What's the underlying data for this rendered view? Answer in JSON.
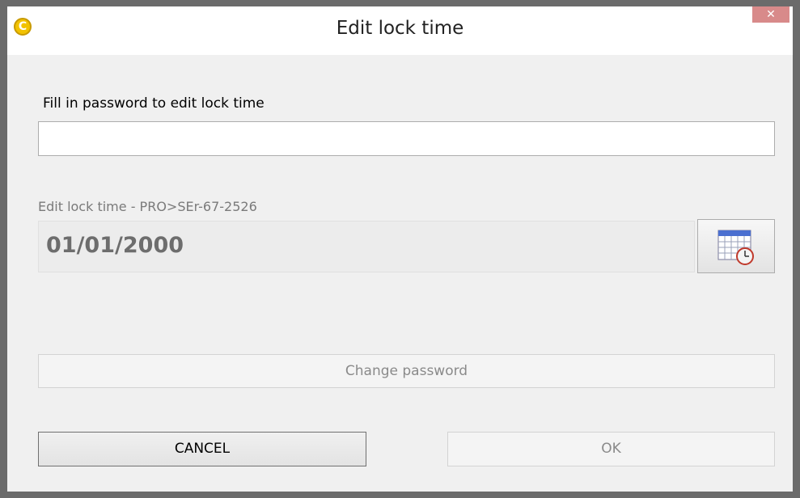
{
  "window": {
    "title": "Edit lock time",
    "app_icon_letter": "C",
    "close_symbol": "✕"
  },
  "password": {
    "label": "Fill in password to edit lock time",
    "value": "",
    "placeholder": ""
  },
  "lock_time": {
    "label": "Edit lock time - PRO>SEr-67-2526",
    "date_value": "01/01/2000",
    "calendar_icon": "calendar-clock-icon"
  },
  "buttons": {
    "change_password": "Change password",
    "cancel": "CANCEL",
    "ok": "OK"
  },
  "colors": {
    "app_icon": "#f2c200",
    "close_button": "#d88a8a",
    "disabled_text": "#8a8a8a",
    "dialog_bg": "#f0f0f0"
  }
}
